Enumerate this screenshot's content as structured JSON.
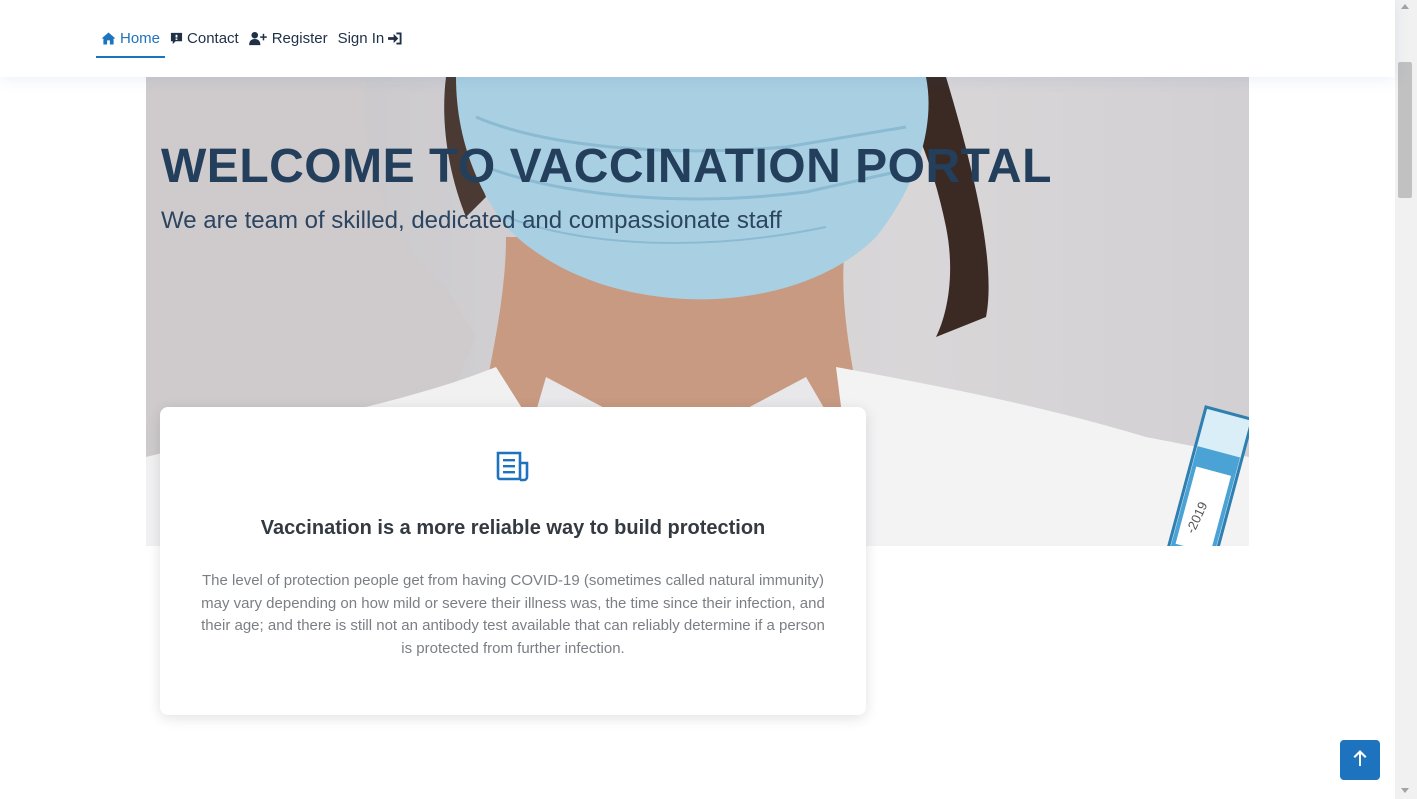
{
  "nav": {
    "items": [
      {
        "label": "Home",
        "icon": "home-icon",
        "active": true
      },
      {
        "label": "Contact",
        "icon": "message-icon",
        "active": false
      },
      {
        "label": "Register",
        "icon": "user-plus-icon",
        "active": false
      },
      {
        "label": "Sign In",
        "icon": "sign-in-icon",
        "active": false
      }
    ]
  },
  "hero": {
    "title": "WELCOME TO VACCINATION PORTAL",
    "subtitle": "We are team of skilled, dedicated and compassionate staff",
    "vial_text": "-2019"
  },
  "card": {
    "icon": "document-icon",
    "title": "Vaccination is a more reliable way to build protection",
    "text": "The level of protection people get from having COVID-19 (sometimes called natural immunity) may vary depending on how mild or severe their illness was, the time since their infection, and their age; and there is still not an antibody test available that can reliably determine if a person is protected from further infection."
  },
  "back_to_top": {
    "icon": "arrow-up-icon"
  },
  "colors": {
    "accent": "#1e73be",
    "heading": "#243f5c",
    "text_muted": "#7b7f84"
  }
}
